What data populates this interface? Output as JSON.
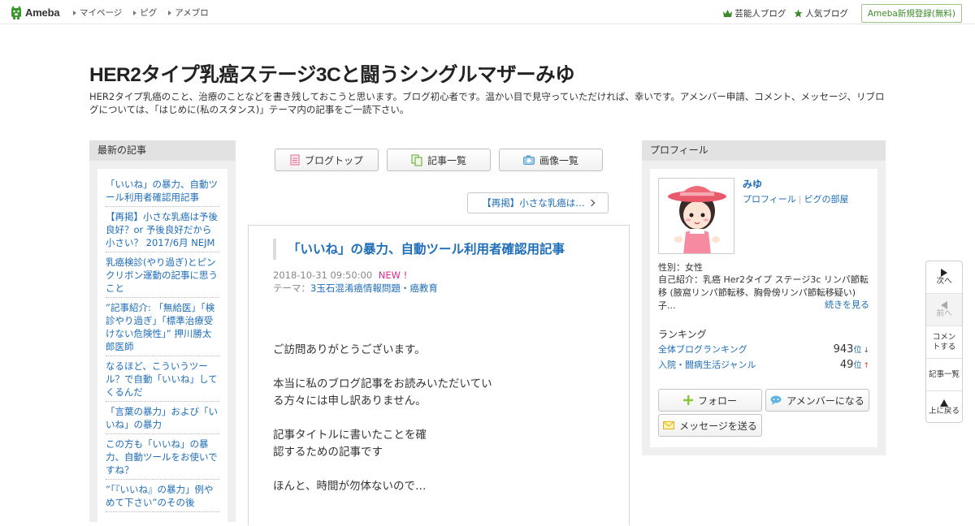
{
  "topbar": {
    "logo_text": "Ameba",
    "nav": [
      "マイページ",
      "ピグ",
      "アメブロ"
    ],
    "right_links": [
      "芸能人ブログ",
      "人気ブログ"
    ],
    "register_label": "Ameba新規登録(無料)"
  },
  "header": {
    "title": "HER2タイプ乳癌ステージ3Cと闘うシングルマザーみゆ",
    "description": "HER2タイプ乳癌のこと、治療のことなどを書き残しておこうと思います。ブログ初心者です。温かい目で見守っていただければ、幸いです。アメンバー申請、コメント、メッセージ、リブログについては、「はじめに(私のスタンス)」テーマ内の記事をご一読下さい。"
  },
  "left_sidebar": {
    "heading": "最新の記事",
    "items": [
      "「いいね」の暴力、自動ツール利用者確認用記事",
      "【再掲】小さな乳癌は予後良好？or 予後良好だから小さい？ 2017/6月 NEJM",
      "乳癌検診(やり過ぎ)とピンクリボン運動の記事に思うこと",
      "”記事紹介: 「無給医」「検診やり過ぎ」「標準治療受けない危険性」” 押川勝太郎医師",
      "なるほど、こういうツール？で自動「いいね」してくるんだ",
      "「言葉の暴力」および「いいね」の暴力",
      "この方も「いいね」の暴力、自動ツールをお使いですね？",
      "”「『いいね』の暴力」例やめて下さい”のその後"
    ]
  },
  "main": {
    "buttons": [
      "ブログトップ",
      "記事一覧",
      "画像一覧"
    ],
    "prev_post": "【再掲】小さな乳癌は…",
    "article": {
      "title": "「いいね」の暴力、自動ツール利用者確認用記事",
      "date": "2018-10-31 09:50:00",
      "new_label": "NEW !",
      "theme_prefix": "テーマ：",
      "theme": "3玉石混淆癌情報問題・癌教育",
      "paragraphs": [
        "ご訪問ありがとうございます。",
        "本当に私のブログ記事をお読みいただいている方々には申し訳ありません。",
        "記事タイトルに書いたことを確認するための記事です",
        "ほんと、時間が勿体ないので…"
      ]
    }
  },
  "right_sidebar": {
    "heading": "プロフィール",
    "name": "みゆ",
    "links": [
      "プロフィール",
      "ピグの部屋"
    ],
    "gender": "性別：女性",
    "intro": "自己紹介：乳癌 Her2タイプ ステージ3c リンパ節転移 (腋窩リンパ節転移、胸骨傍リンパ節転移疑い) 子...",
    "more": "続きを見る",
    "ranking_heading": "ランキング",
    "rankings": [
      {
        "label": "全体ブログランキング",
        "value": "943",
        "unit": "位",
        "trend": "↓"
      },
      {
        "label": "入院・闘病生活ジャンル",
        "value": "49",
        "unit": "位",
        "trend": "↑"
      }
    ],
    "follow_label": "フォロー",
    "amember_label": "アメンバーになる",
    "message_label": "メッセージを送る"
  },
  "float_nav": [
    "次へ",
    "前へ",
    "コメントする",
    "記事一覧",
    "上に戻る"
  ]
}
